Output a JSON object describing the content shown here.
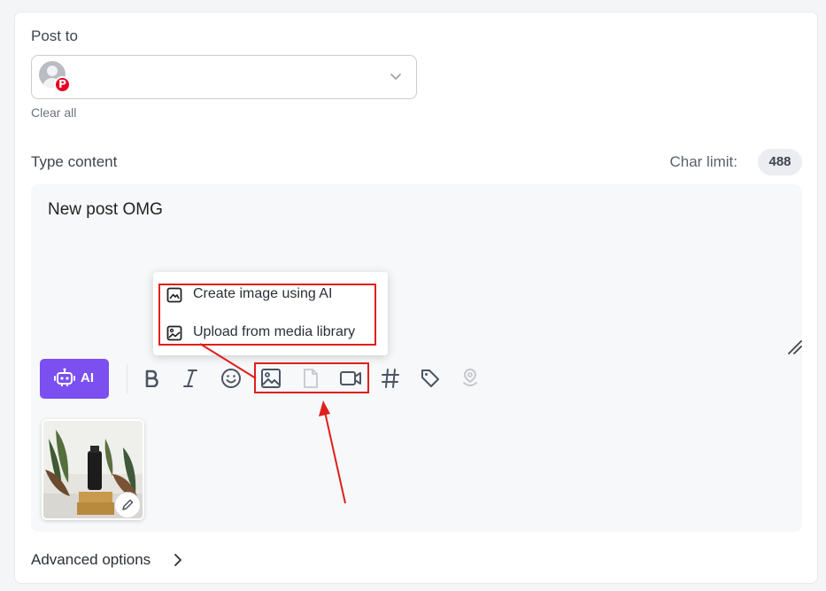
{
  "post_to": {
    "label": "Post to",
    "clear_all": "Clear all",
    "platform_badge": "P"
  },
  "content": {
    "label": "Type content",
    "char_limit_label": "Char limit:",
    "char_limit_value": "488",
    "text": "New post OMG"
  },
  "toolbar": {
    "ai_label": "AI",
    "tools": [
      "bold-icon",
      "italic-icon",
      "emoji-icon",
      "image-icon",
      "file-icon",
      "video-icon",
      "hashtag-icon",
      "tag-icon",
      "location-icon"
    ]
  },
  "image_menu": {
    "items": [
      {
        "label": "Create image using AI",
        "icon": "ai-image-icon"
      },
      {
        "label": "Upload from media library",
        "icon": "media-library-icon"
      }
    ]
  },
  "advanced_options": "Advanced options",
  "colors": {
    "accent": "#7b4ff0",
    "pinterest": "#e60023",
    "highlight": "#e01e1e"
  }
}
